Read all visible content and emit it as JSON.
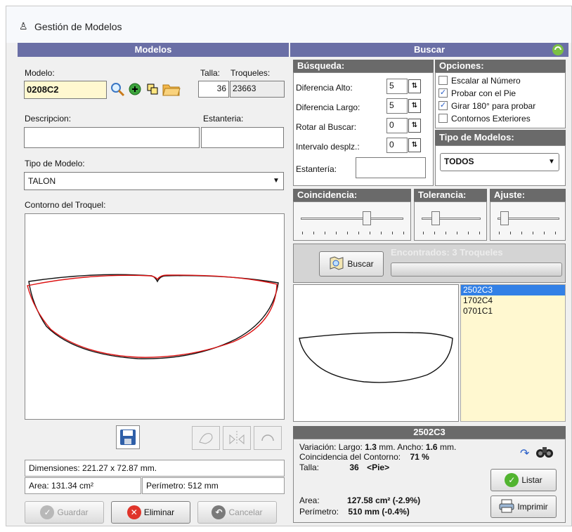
{
  "window": {
    "title": "Gestión de Modelos"
  },
  "left": {
    "header": "Modelos",
    "modelo_label": "Modelo:",
    "modelo_value": "0208C2",
    "talla_label": "Talla:",
    "troqueles_label": "Troqueles:",
    "talla_value": "36",
    "troqueles_value": "23663",
    "descripcion_label": "Descripcion:",
    "descripcion_value": "",
    "estanteria_label": "Estanteria:",
    "estanteria_value": "",
    "tipo_label": "Tipo de Modelo:",
    "tipo_value": "TALON",
    "contorno_label": "Contorno del Troquel:",
    "dimensiones": "Dimensiones: 221.27 x 72.87 mm.",
    "area": "Area: 131.34 cm²",
    "perimetro": "Perímetro: 512 mm",
    "buttons": {
      "guardar": "Guardar",
      "eliminar": "Eliminar",
      "cancelar": "Cancelar"
    }
  },
  "right": {
    "header": "Buscar",
    "busqueda": {
      "title": "Búsqueda:",
      "dif_alto_label": "Diferencia Alto:",
      "dif_alto": "5",
      "dif_largo_label": "Diferencia Largo:",
      "dif_largo": "5",
      "rotar_label": "Rotar al Buscar:",
      "rotar": "0",
      "intervalo_label": "Intervalo desplz.:",
      "intervalo": "0",
      "estanteria_label": "Estantería:",
      "estanteria": ""
    },
    "opciones": {
      "title": "Opciones:",
      "items": [
        {
          "label": "Escalar al Número",
          "checked": false
        },
        {
          "label": "Probar con el Pie",
          "checked": true
        },
        {
          "label": "Girar 180° para probar",
          "checked": true
        },
        {
          "label": "Contornos Exteriores",
          "checked": false
        }
      ]
    },
    "tipo_modelos": {
      "title": "Tipo de Modelos:",
      "value": "TODOS"
    },
    "sliders": {
      "coincidencia": "Coincidencia:",
      "tolerancia": "Tolerancia:",
      "ajuste": "Ajuste:"
    },
    "buscar_button": "Buscar",
    "encontrados_text": "Encontrados:   3   Troqueles",
    "results": [
      "2502C3",
      "1702C4",
      "0701C1"
    ],
    "selected_result": "2502C3",
    "detail": {
      "title": "2502C3",
      "variacion_label": "Variación: Largo:",
      "largo": "1.3",
      "mm_ancho": "mm. Ancho:",
      "ancho": "1.6",
      "mm": "mm.",
      "coincidencia_label": "Coincidencia del Contorno:",
      "coincidencia": "71",
      "percent": "%",
      "talla_label": "Talla:",
      "talla": "36",
      "pie": "<Pie>",
      "area_label": "Area:",
      "area": "127.58 cm² (-2.9%)",
      "perimetro_label": "Perímetro:",
      "perimetro": "510 mm (-0.4%)"
    },
    "listar_button": "Listar",
    "imprimir_button": "Imprimir"
  },
  "colors": {
    "header": "#6a6fa6",
    "section": "#6a6a6a",
    "list_bg": "#fff8d0",
    "selection": "#3280e6"
  }
}
